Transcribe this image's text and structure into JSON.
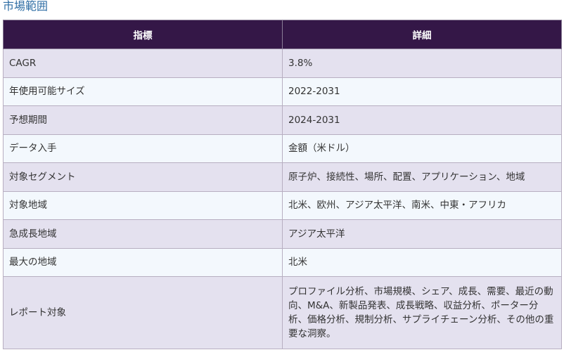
{
  "section": {
    "title": "市場範囲"
  },
  "table": {
    "headers": [
      "指標",
      "詳細"
    ],
    "rows": [
      {
        "metric": "CAGR",
        "detail": "3.8%"
      },
      {
        "metric": "年使用可能サイズ",
        "detail": "2022-2031"
      },
      {
        "metric": "予想期間",
        "detail": "2024-2031"
      },
      {
        "metric": "データ入手",
        "detail": "金額（米ドル）"
      },
      {
        "metric": "対象セグメント",
        "detail": "原子炉、接続性、場所、配置、アプリケーション、地域"
      },
      {
        "metric": "対象地域",
        "detail": "北米、欧州、アジア太平洋、南米、中東・アフリカ"
      },
      {
        "metric": "急成長地域",
        "detail": "アジア太平洋"
      },
      {
        "metric": "最大の地域",
        "detail": "北米"
      },
      {
        "metric": "レポート対象",
        "detail": "プロファイル分析、市場規模、シェア、成長、需要、最近の動向、M&A、新製品発表、成長戦略、収益分析、ポーター分析、価格分析、規制分析、サプライチェーン分析、その他の重要な洞察。"
      }
    ]
  },
  "colors": {
    "header_bg": "#341747",
    "header_text": "#ffffff",
    "row_odd": "#e4e1ef",
    "row_even": "#f3f8fd",
    "title_link": "#2e6da4"
  }
}
